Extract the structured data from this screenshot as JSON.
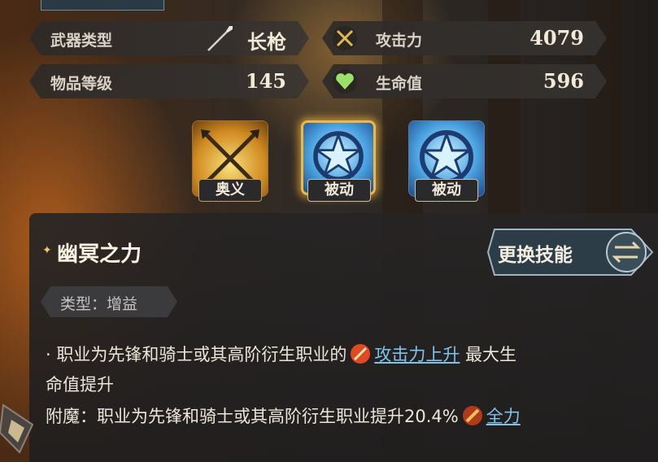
{
  "stats": {
    "weapon_type_label": "武器类型",
    "weapon_type_value": "长枪",
    "attack_label": "攻击力",
    "attack_value": "4079",
    "item_level_label": "物品等级",
    "item_level_value": "145",
    "hp_label": "生命值",
    "hp_value": "596"
  },
  "skills": [
    {
      "tag": "奥义",
      "icon": "crossed-spears-icon"
    },
    {
      "tag": "被动",
      "icon": "star-emblem-icon",
      "selected": true
    },
    {
      "tag": "被动",
      "icon": "star-emblem-icon"
    }
  ],
  "detail": {
    "name": "幽冥之力",
    "change_skill_label": "更换技能",
    "type_label": "类型：增益",
    "line1_prefix": "· 职业为先锋和骑士或其高阶衍生职业的",
    "line1_link": "攻击力上升",
    "line1_suffix": "最大生",
    "line2": "命值提升",
    "line3_prefix": "附魔：职业为先锋和骑士或其高阶衍生职业提升20.4%",
    "line3_link": "全力"
  },
  "colors": {
    "link": "#7ec4ea",
    "selected_glow": "#f3b640",
    "star_bullet": "#f3c768"
  }
}
